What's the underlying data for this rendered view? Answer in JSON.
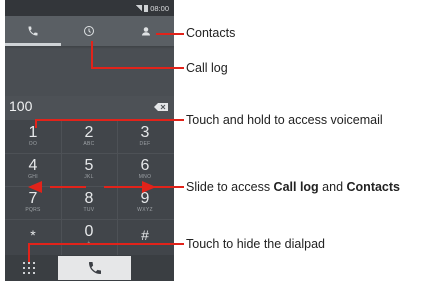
{
  "phone": {
    "status_time": "08:00",
    "tabs": [
      {
        "icon": "phone-icon"
      },
      {
        "icon": "clock-icon"
      },
      {
        "icon": "contact-icon"
      }
    ],
    "dialed_number": "100",
    "keys": [
      {
        "digit": "1",
        "letters": "OO"
      },
      {
        "digit": "2",
        "letters": "ABC"
      },
      {
        "digit": "3",
        "letters": "DEF"
      },
      {
        "digit": "4",
        "letters": "GHI"
      },
      {
        "digit": "5",
        "letters": "JKL"
      },
      {
        "digit": "6",
        "letters": "MNO"
      },
      {
        "digit": "7",
        "letters": "PQRS"
      },
      {
        "digit": "8",
        "letters": "TUV"
      },
      {
        "digit": "9",
        "letters": "WXYZ"
      },
      {
        "digit": "*",
        "letters": ""
      },
      {
        "digit": "0",
        "letters": "+"
      },
      {
        "digit": "#",
        "letters": ""
      }
    ]
  },
  "annotations": {
    "contacts": "Contacts",
    "call_log": "Call log",
    "voicemail": "Touch and hold to access voicemail",
    "slide_prefix": "Slide to access ",
    "slide_call_log": "Call log",
    "slide_and": " and ",
    "slide_contacts": "Contacts",
    "hide_dialpad": "Touch to hide the dialpad"
  },
  "colors": {
    "annotation_line": "#e2231a",
    "phone_bg": "#3b3f44"
  }
}
